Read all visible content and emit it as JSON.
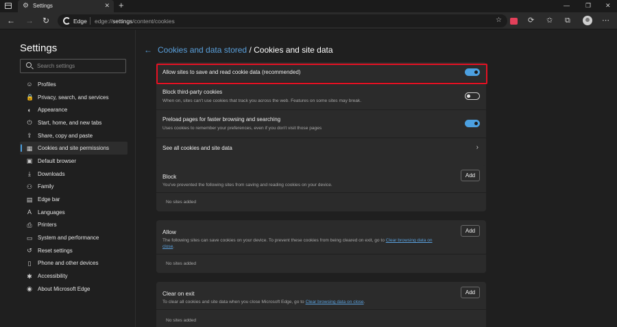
{
  "tab": {
    "title": "Settings",
    "icon": "gear-icon"
  },
  "address": {
    "brand": "Edge",
    "url_prefix": "edge://",
    "url_host": "settings",
    "url_path": "/content/cookies"
  },
  "sidebar": {
    "title": "Settings",
    "search_placeholder": "Search settings",
    "items": [
      {
        "label": "Profiles",
        "icon": "profile-icon",
        "glyph": "☺"
      },
      {
        "label": "Privacy, search, and services",
        "icon": "lock-icon",
        "glyph": "🔒"
      },
      {
        "label": "Appearance",
        "icon": "appearance-icon",
        "glyph": "◐"
      },
      {
        "label": "Start, home, and new tabs",
        "icon": "power-icon",
        "glyph": "⏻"
      },
      {
        "label": "Share, copy and paste",
        "icon": "share-icon",
        "glyph": "⇪"
      },
      {
        "label": "Cookies and site permissions",
        "icon": "permissions-icon",
        "glyph": "▦",
        "active": true
      },
      {
        "label": "Default browser",
        "icon": "browser-icon",
        "glyph": "▣"
      },
      {
        "label": "Downloads",
        "icon": "download-icon",
        "glyph": "⤓"
      },
      {
        "label": "Family",
        "icon": "family-icon",
        "glyph": "⚇"
      },
      {
        "label": "Edge bar",
        "icon": "edge-bar-icon",
        "glyph": "▤"
      },
      {
        "label": "Languages",
        "icon": "languages-icon",
        "glyph": "A"
      },
      {
        "label": "Printers",
        "icon": "printer-icon",
        "glyph": "⎙"
      },
      {
        "label": "System and performance",
        "icon": "system-icon",
        "glyph": "▭"
      },
      {
        "label": "Reset settings",
        "icon": "reset-icon",
        "glyph": "↺"
      },
      {
        "label": "Phone and other devices",
        "icon": "phone-icon",
        "glyph": "▯"
      },
      {
        "label": "Accessibility",
        "icon": "accessibility-icon",
        "glyph": "✱"
      },
      {
        "label": "About Microsoft Edge",
        "icon": "edge-icon",
        "glyph": "◉"
      }
    ]
  },
  "breadcrumb": {
    "parent": "Cookies and data stored",
    "separator": "/",
    "current": "Cookies and site data"
  },
  "settings": {
    "allow_cookies": {
      "title": "Allow sites to save and read cookie data (recommended)",
      "on": true
    },
    "block_third_party": {
      "title": "Block third-party cookies",
      "desc": "When on, sites can't use cookies that track you across the web. Features on some sites may break.",
      "on": false
    },
    "preload": {
      "title": "Preload pages for faster browsing and searching",
      "desc": "Uses cookies to remember your preferences, even if you don't visit those pages",
      "on": true
    },
    "see_all": {
      "title": "See all cookies and site data"
    }
  },
  "block": {
    "title": "Block",
    "desc": "You've prevented the following sites from saving and reading cookies on your device.",
    "add_label": "Add",
    "empty": "No sites added"
  },
  "allow": {
    "title": "Allow",
    "desc_before": "The following sites can save cookies on your device. To prevent these cookies from being cleared on exit, go to ",
    "link": "Clear browsing data on",
    "link_wrap": "close",
    "desc_after": ".",
    "add_label": "Add",
    "empty": "No sites added"
  },
  "clear_on_exit": {
    "title": "Clear on exit",
    "desc_before": "To clear all cookies and site data when you close Microsoft Edge, go to ",
    "link": "Clear browsing data on close",
    "desc_after": ".",
    "add_label": "Add",
    "empty": "No sites added"
  }
}
